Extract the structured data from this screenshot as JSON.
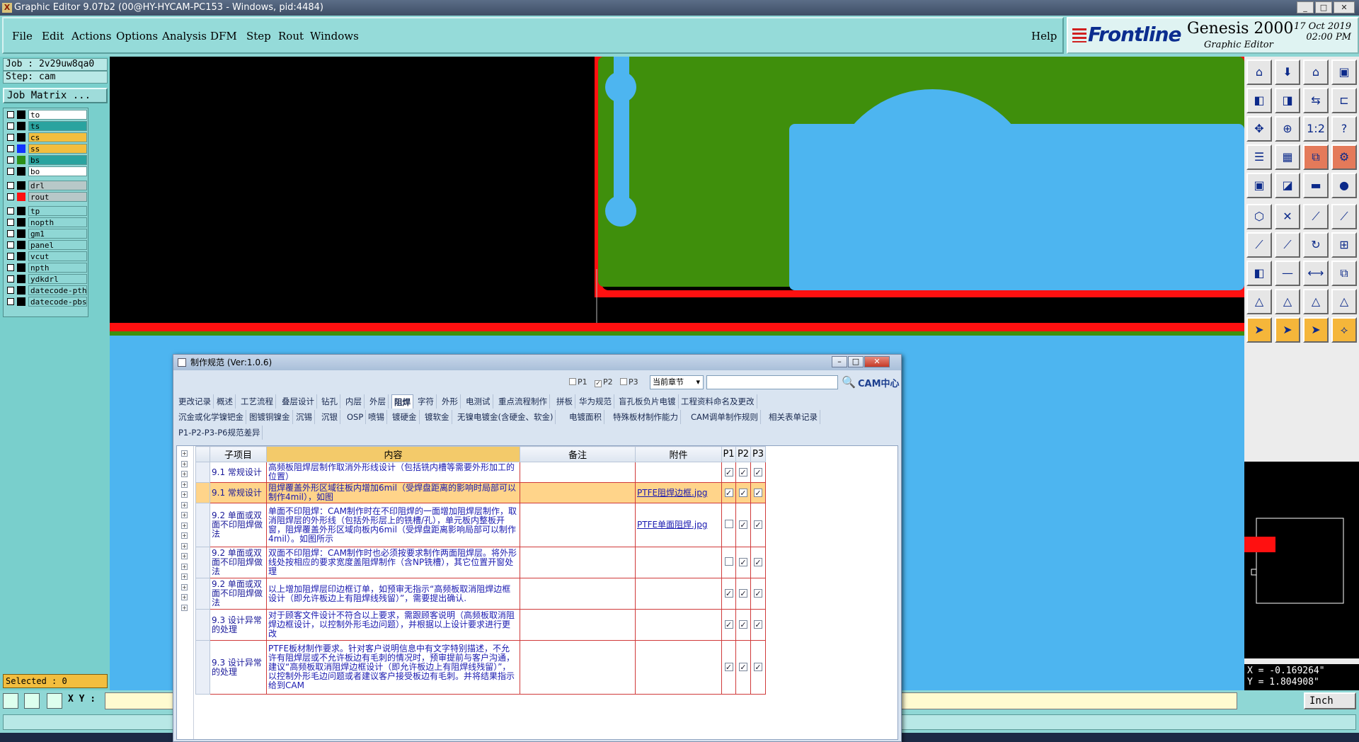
{
  "window": {
    "title": "Graphic Editor 9.07b2 (00@HY-HYCAM-PC153 - Windows, pid:4484)"
  },
  "menu": {
    "items": [
      "File",
      "Edit",
      "Actions",
      "Options",
      "Analysis",
      "DFM",
      "Step",
      "Rout",
      "Windows"
    ],
    "help": "Help"
  },
  "brand": {
    "logo": "Frontline",
    "product": "Genesis 2000",
    "subtitle": "Graphic Editor",
    "date": "17 Oct 2019",
    "time": "02:00 PM"
  },
  "left": {
    "job": "Job : 2v29uw8qa0",
    "step": "Step: cam",
    "job_matrix": "Job Matrix ...",
    "layers_group1": [
      {
        "name": "to",
        "swatch": "#000000",
        "bg": "#ffffff"
      },
      {
        "name": "ts",
        "swatch": "#000000",
        "bg": "#2aa39f"
      },
      {
        "name": "cs",
        "swatch": "#000000",
        "bg": "#f2be3e"
      },
      {
        "name": "ss",
        "swatch": "#1133ff",
        "bg": "#f2be3e"
      },
      {
        "name": "bs",
        "swatch": "#2c8f18",
        "bg": "#2aa39f"
      },
      {
        "name": "bo",
        "swatch": "#000000",
        "bg": "#ffffff"
      }
    ],
    "layers_group2": [
      {
        "name": "drl",
        "swatch": "#000000",
        "bg": "#b8c8c8"
      },
      {
        "name": "rout",
        "swatch": "#ff1010",
        "bg": "#b8c8c8"
      }
    ],
    "layers_group3": [
      {
        "name": "tp",
        "swatch": "#000000",
        "bg": "#8fd7d5"
      },
      {
        "name": "nopth",
        "swatch": "#000000",
        "bg": "#8fd7d5"
      },
      {
        "name": "gm1",
        "swatch": "#000000",
        "bg": "#8fd7d5"
      },
      {
        "name": "panel",
        "swatch": "#000000",
        "bg": "#8fd7d5"
      },
      {
        "name": "vcut",
        "swatch": "#000000",
        "bg": "#8fd7d5"
      },
      {
        "name": "npth",
        "swatch": "#000000",
        "bg": "#8fd7d5"
      },
      {
        "name": "ydkdrl",
        "swatch": "#000000",
        "bg": "#8fd7d5"
      },
      {
        "name": "datecode-pth",
        "swatch": "#000000",
        "bg": "#8fd7d5"
      },
      {
        "name": "datecode-pbs",
        "swatch": "#000000",
        "bg": "#8fd7d5"
      }
    ],
    "selected": "Selected : 0"
  },
  "bottom": {
    "xy_label": "X Y :",
    "xy_value": "",
    "unit": "Inch"
  },
  "coords": {
    "x": "X = -0.169264\"",
    "y": "Y = 1.804908\""
  },
  "dialog": {
    "title": "制作规范 (Ver:1.0.6)",
    "filters": [
      "P1",
      "P2",
      "P3"
    ],
    "filters_checked": [
      false,
      true,
      false
    ],
    "scope": "当前章节",
    "search_value": "",
    "logo_text": "CAM中心",
    "tabs_row1": [
      "更改记录",
      "概述",
      "工艺流程",
      "叠层设计",
      "钻孔",
      "内层",
      "外层",
      "阻焊",
      "字符",
      "外形",
      "电测试",
      "重点流程制作",
      "拼板",
      "华为规范",
      "盲孔板负片电镀",
      "工程资料命名及更改"
    ],
    "tabs_row2": [
      "沉金或化学镍钯金",
      "图镀铜镍金",
      "沉锡",
      "沉银",
      "OSP",
      "喷锡",
      "镀硬金",
      "镀软金",
      "无镍电镀金(含硬金、软金)",
      "电镀面积",
      "特殊板材制作能力",
      "CAM调单制作规则",
      "相关表单记录"
    ],
    "tabs_row3": [
      "P1-P2-P3-P6规范差异"
    ],
    "active_tab": "阻焊",
    "columns": [
      "子项目",
      "内容",
      "备注",
      "附件",
      "P1",
      "P2",
      "P3"
    ],
    "rows": [
      {
        "sub": "9.1 常规设计",
        "content": "高频板阻焊层制作取消外形线设计（包括铣内槽等需要外形加工的位置）",
        "note": "",
        "attach": "",
        "p": [
          true,
          true,
          true
        ]
      },
      {
        "sub": "9.1 常规设计",
        "content": "阻焊覆盖外形区域往板内增加6mil（受焊盘距离的影响时局部可以制作4mil），如图",
        "note": "",
        "attach": "PTFE阻焊边框.jpg",
        "p": [
          true,
          true,
          true
        ]
      },
      {
        "sub": "9.2 单面或双面不印阻焊做法",
        "content": "单面不印阻焊：CAM制作时在不印阻焊的一面增加阻焊层制作，取消阻焊层的外形线（包括外形层上的铣槽/孔），单元板内整板开窗，阻焊覆盖外形区域向板内6mil（受焊盘距离影响局部可以制作4mil）。如图所示",
        "note": "",
        "attach": "PTFE单面阻焊.jpg",
        "p": [
          false,
          true,
          true
        ]
      },
      {
        "sub": "9.2 单面或双面不印阻焊做法",
        "content": "双面不印阻焊：CAM制作时也必须按要求制作两面阻焊层。将外形线处按相应的要求宽度盖阻焊制作（含NP铣槽），其它位置开窗处理",
        "note": "",
        "attach": "",
        "p": [
          false,
          true,
          true
        ]
      },
      {
        "sub": "9.2 单面或双面不印阻焊做法",
        "content": "以上增加阻焊层印边框订单，如预审无指示“高频板取消阻焊边框设计（即允许板边上有阻焊线残留）”，需要提出确认.",
        "note": "",
        "attach": "",
        "p": [
          true,
          true,
          true
        ]
      },
      {
        "sub": "9.3 设计异常的处理",
        "content": "对于顾客文件设计不符合以上要求，需跟顾客说明（高频板取消阻焊边框设计，以控制外形毛边问题），并根据以上设计要求进行更改",
        "note": "",
        "attach": "",
        "p": [
          true,
          true,
          true
        ]
      },
      {
        "sub": "9.3 设计异常的处理",
        "content": "PTFE板材制作要求。针对客户说明信息中有文字特别描述，不允许有阻焊层或不允许板边有毛刺的情况时，预审提前与客户沟通，建议“高频板取消阻焊边框设计（即允许板边上有阻焊线残留）”，以控制外形毛边问题或者建议客户接受板边有毛刺。并将结果指示给到CAM",
        "note": "",
        "attach": "",
        "p": [
          true,
          true,
          true
        ]
      }
    ],
    "highlighted_row": 1
  },
  "colors": {
    "teal": "#8fd7d5",
    "board_green": "#3f8f0c",
    "pad_blue": "#4db5f0",
    "rout_red": "#ff1010"
  }
}
